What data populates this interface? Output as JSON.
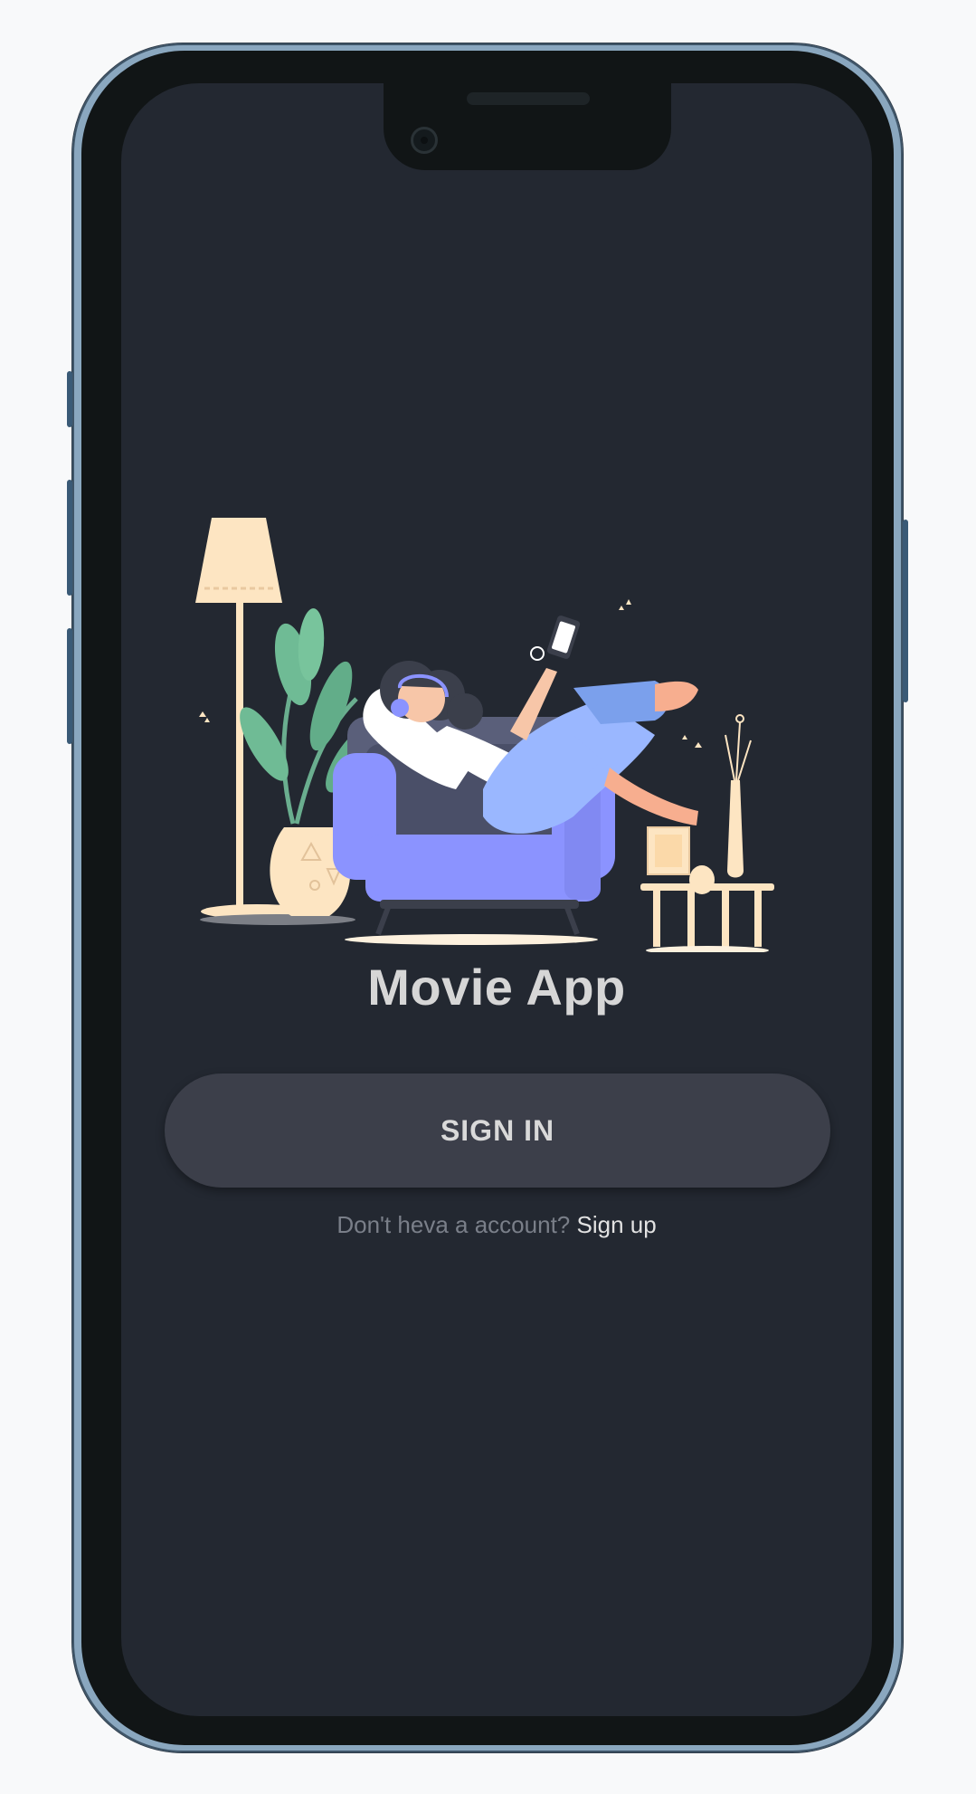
{
  "app": {
    "title": "Movie App"
  },
  "actions": {
    "sign_in_label": "SIGN IN",
    "no_account_text": "Don't heva a account?",
    "sign_up_label": "Sign up"
  },
  "illustration": {
    "subject": "woman relaxing on armchair with headphones and phone",
    "icons": [
      "floor-lamp-icon",
      "plant-icon",
      "armchair-icon",
      "side-table-icon",
      "vase-icon"
    ]
  },
  "colors": {
    "screen_bg": "#232831",
    "button_bg": "#3c3f4a",
    "title_text": "#d6d6d6",
    "muted_text": "#7a7f89",
    "accent_purple": "#8b93ff",
    "accent_blue": "#9bb8ff"
  }
}
